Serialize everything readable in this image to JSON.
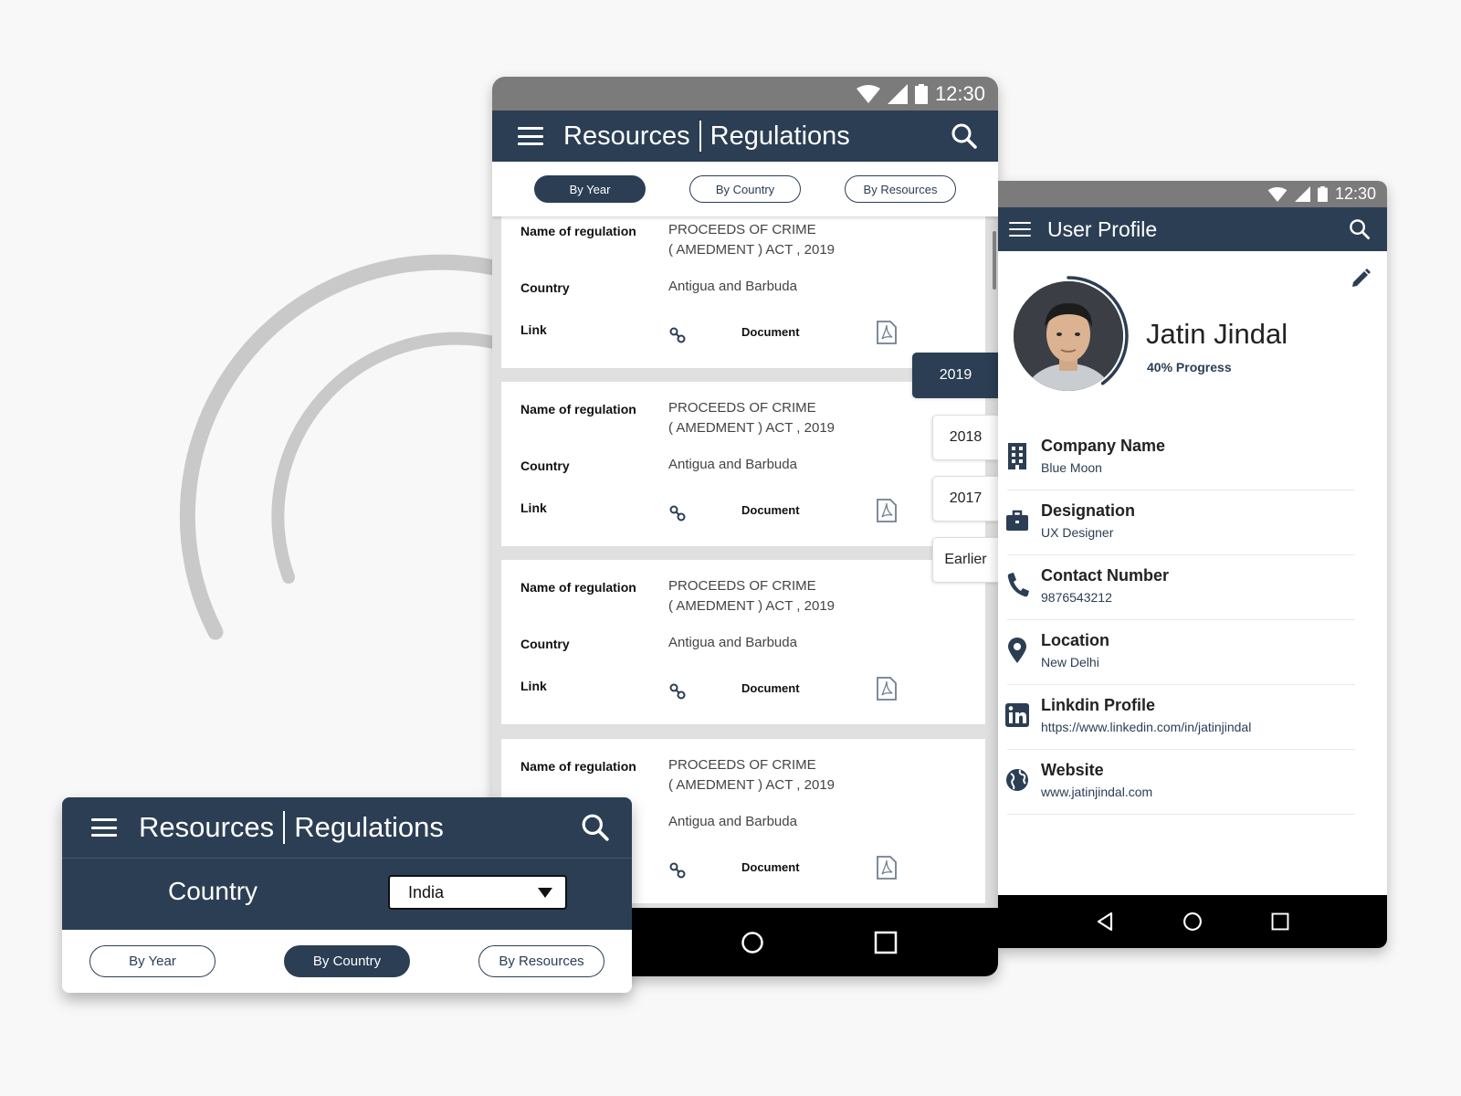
{
  "main_screen": {
    "status_time": "12:30",
    "title_primary": "Resources",
    "title_secondary": "Regulations",
    "filters": [
      "By Year",
      "By Country",
      "By Resources"
    ],
    "active_filter": "By Year",
    "field_labels": {
      "name": "Name of regulation",
      "country": "Country",
      "link": "Link",
      "document": "Document"
    },
    "regulations": [
      {
        "name_line1": "PROCEEDS OF CRIME",
        "name_line2": "( AMEDMENT ) ACT , 2019",
        "country": "Antigua and Barbuda"
      },
      {
        "name_line1": "PROCEEDS OF CRIME",
        "name_line2": "( AMEDMENT ) ACT , 2019",
        "country": "Antigua and Barbuda"
      },
      {
        "name_line1": "PROCEEDS OF CRIME",
        "name_line2": "( AMEDMENT ) ACT , 2019",
        "country": "Antigua and Barbuda"
      },
      {
        "name_line1": "PROCEEDS OF CRIME",
        "name_line2": "( AMEDMENT ) ACT , 2019",
        "country": "Antigua and Barbuda"
      }
    ],
    "year_tabs": [
      "2019",
      "2018",
      "2017",
      "Earlier"
    ],
    "active_year": "2019"
  },
  "profile_screen": {
    "status_time": "12:30",
    "title": "User Profile",
    "name": "Jatin Jindal",
    "progress_label": "40% Progress",
    "progress_value": 0.4,
    "items": [
      {
        "icon": "building-icon",
        "label": "Company Name",
        "value": "Blue Moon"
      },
      {
        "icon": "briefcase-icon",
        "label": "Designation",
        "value": "UX Designer"
      },
      {
        "icon": "phone-icon",
        "label": "Contact Number",
        "value": "9876543212"
      },
      {
        "icon": "location-pin-icon",
        "label": "Location",
        "value": "New Delhi"
      },
      {
        "icon": "linkedin-icon",
        "label": "Linkdin Profile",
        "value": "https://www.linkedin.com/in/jatinjindal"
      },
      {
        "icon": "globe-icon",
        "label": "Website",
        "value": "www.jatinjindal.com"
      }
    ]
  },
  "country_filter_card": {
    "title_primary": "Resources",
    "title_secondary": "Regulations",
    "country_label": "Country",
    "selected_country": "India",
    "filters": [
      "By Year",
      "By Country",
      "By Resources"
    ],
    "active_filter": "By Country"
  },
  "colors": {
    "primary_navy": "#2b3e54",
    "status_gray": "#7b7b7b",
    "background": "#f8f8f8",
    "arc_gray": "#c8c8c8"
  }
}
